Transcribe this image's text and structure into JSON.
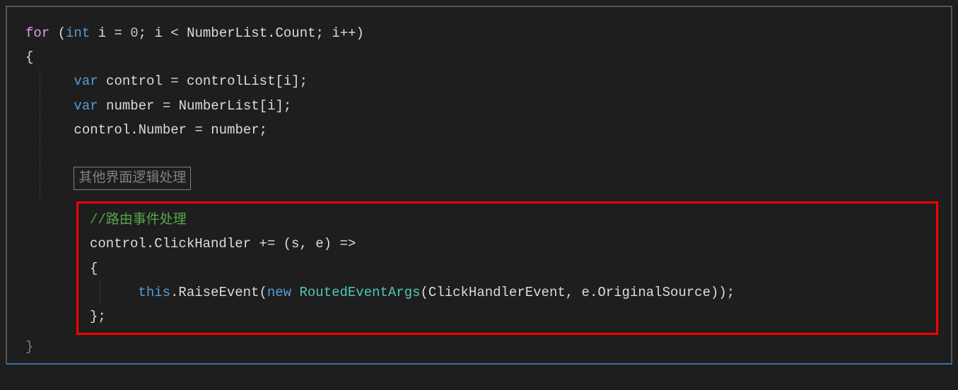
{
  "code": {
    "l1_for": "for",
    "l1_open": " (",
    "l1_int": "int",
    "l1_rest": " i = ",
    "l1_zero": "0",
    "l1_mid": "; i < NumberList.Count; i++)",
    "l2_brace": "{",
    "l3_var": "var",
    "l3_rest": " control = controlList[i];",
    "l4_var": "var",
    "l4_rest": " number = NumberList[i];",
    "l5": "control.Number = number;",
    "region_label": "其他界面逻辑处理",
    "l7_comment": "//路由事件处理",
    "l8": "control.ClickHandler += (s, e) =>",
    "l9_brace": "{",
    "l10_this": "this",
    "l10_dot": ".RaiseEvent(",
    "l10_new": "new",
    "l10_sp": " ",
    "l10_type": "RoutedEventArgs",
    "l10_args": "(ClickHandlerEvent, e.OriginalSource));",
    "l11_brace": "};",
    "l12_brace": "}"
  }
}
